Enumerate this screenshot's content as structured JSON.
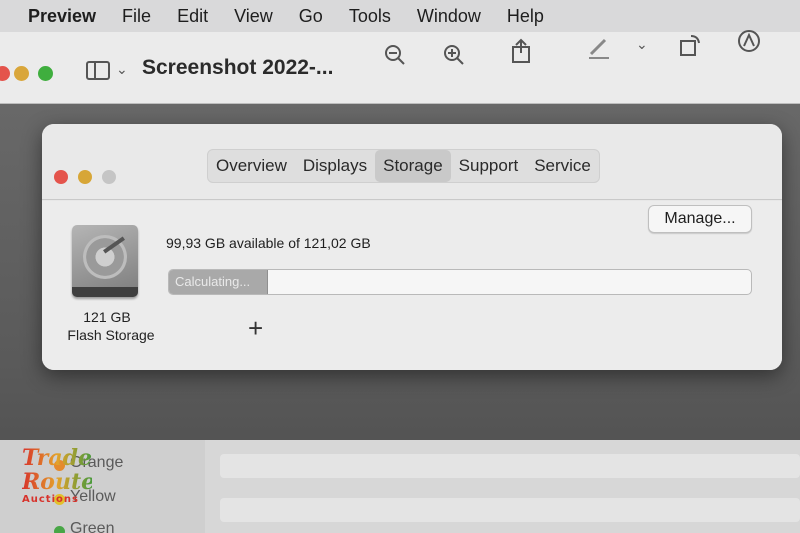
{
  "menubar": {
    "items": [
      "Preview",
      "File",
      "Edit",
      "View",
      "Go",
      "Tools",
      "Window",
      "Help"
    ]
  },
  "toolbar": {
    "document_title": "Screenshot 2022-..."
  },
  "about_window": {
    "tabs": [
      "Overview",
      "Displays",
      "Storage",
      "Support",
      "Service"
    ],
    "selected_tab": "Storage",
    "disk_size": "121 GB",
    "disk_type": "Flash Storage",
    "available_text": "99,93 GB available of 121,02 GB",
    "manage_label": "Manage...",
    "progress_label": "Calculating...",
    "progress_fraction": 0.17,
    "add_symbol": "+"
  },
  "lower_sidebar": {
    "tags": [
      {
        "label": "Orange",
        "color": "#e58a2c"
      },
      {
        "label": "Yellow",
        "color": "#e2c02b"
      },
      {
        "label": "Green",
        "color": "#48a646"
      }
    ]
  },
  "watermark": {
    "line1": "Trade",
    "line2": "Route",
    "line3": "Auctions"
  },
  "colors": {
    "close": "#e4544c",
    "minimize": "#d7a637",
    "zoom": "#3fae3e"
  }
}
